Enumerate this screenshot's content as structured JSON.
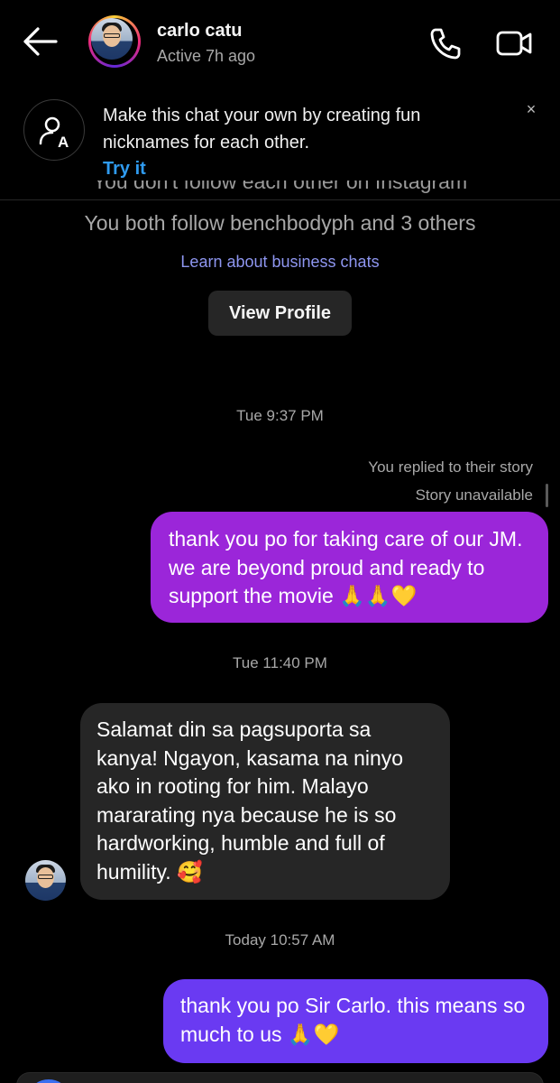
{
  "header": {
    "name": "carlo catu",
    "status": "Active 7h ago"
  },
  "banner": {
    "text": "Make this chat your own by creating fun nicknames for each other.",
    "cta": "Try it",
    "close": "×"
  },
  "profile_info": {
    "cut_line": "You don't follow each other on Instagram",
    "follow_line": "You both follow benchbodyph and 3 others",
    "learn_link": "Learn about business chats",
    "view_profile": "View Profile"
  },
  "messages": {
    "ts1": "Tue 9:37 PM",
    "reply_label": "You replied to their story",
    "story_unavailable": "Story unavailable",
    "out1": "thank you po for taking care of our JM. we are beyond proud and ready to support the movie 🙏🙏💛",
    "ts2": "Tue 11:40 PM",
    "in1": "Salamat din sa pagsuporta sa kanya! Ngayon, kasama na ninyo ako in rooting for him. Malayo mararating nya because he is so hardworking, humble and full of humility. 🥰",
    "ts3": "Today 10:57 AM",
    "out2": "thank you po Sir Carlo. this means so much to us 🙏💛"
  },
  "colors": {
    "outgoing_purple": "#9b26d9",
    "outgoing_violet": "#6a3af2",
    "incoming": "#262626",
    "link_blue": "#2f9bf0",
    "learn_link": "#8e96f0"
  },
  "icons": [
    "back-arrow-icon",
    "phone-icon",
    "video-camera-icon",
    "nickname-icon",
    "close-icon"
  ]
}
